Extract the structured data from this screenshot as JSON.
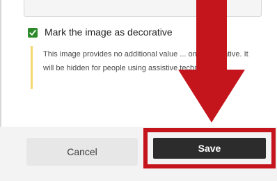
{
  "dialog": {
    "checkbox": {
      "checked": true,
      "label": "Mark the image as decorative"
    },
    "help_text": "This image provides no additional value ... only decorative. It will be hidden for people using assistive technologies.",
    "cancel_label": "Cancel",
    "save_label": "Save"
  },
  "annotation": {
    "arrow_color": "#c4141c",
    "highlight_color": "#c4141c"
  }
}
